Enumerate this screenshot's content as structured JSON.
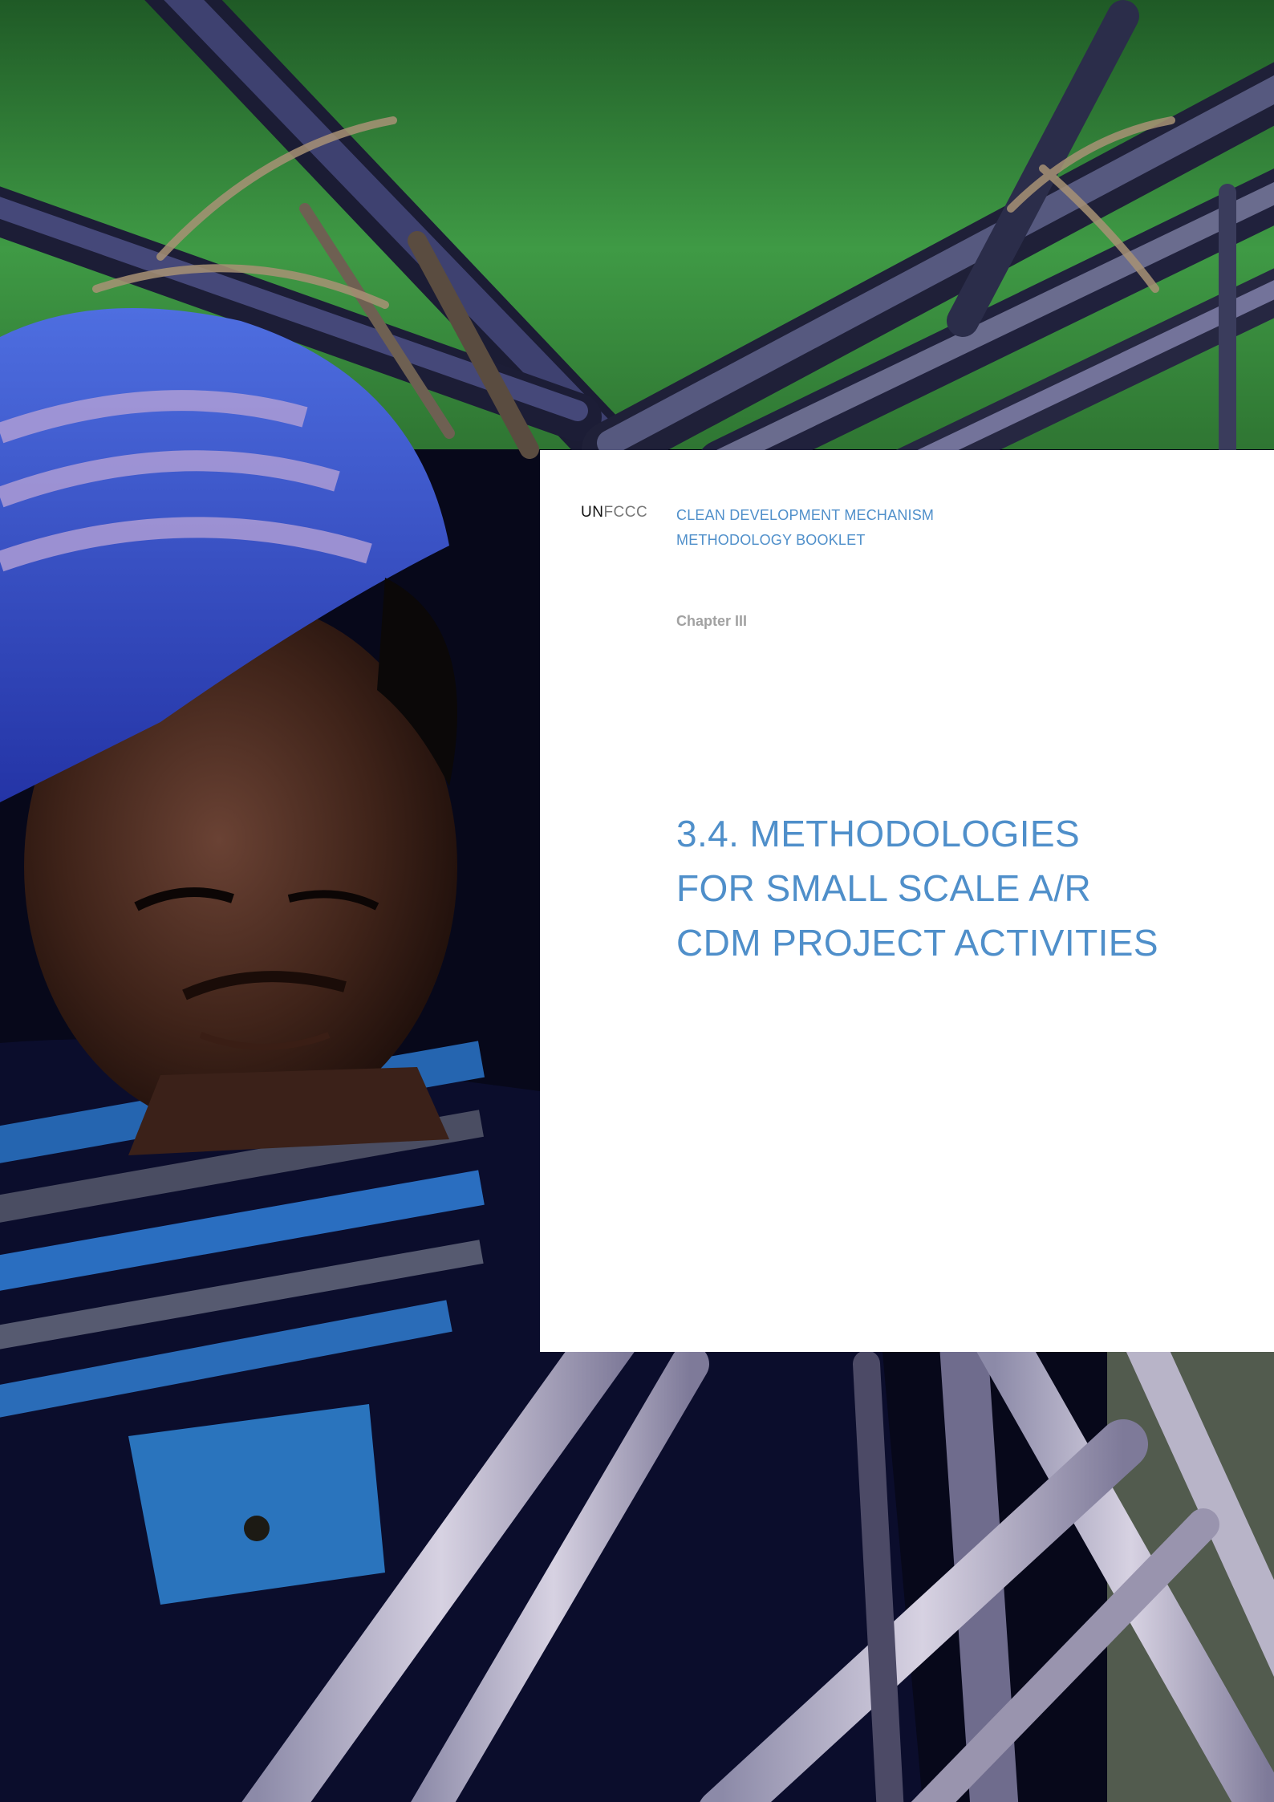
{
  "logo": {
    "un": "UN",
    "fccc": "FCCC"
  },
  "header": {
    "line1": "CLEAN DEVELOPMENT MECHANISM",
    "line2": "METHODOLOGY BOOKLET"
  },
  "chapter": "Chapter III",
  "title": {
    "line1": "3.4.  METHODOLOGIES",
    "line2": "FOR SMALL SCALE A/R",
    "line3": "CDM PROJECT ACTIVITIES"
  },
  "colors": {
    "accent_blue": "#4f8fca",
    "chapter_gray": "#a2a2a2",
    "panel": "#ffffff"
  }
}
